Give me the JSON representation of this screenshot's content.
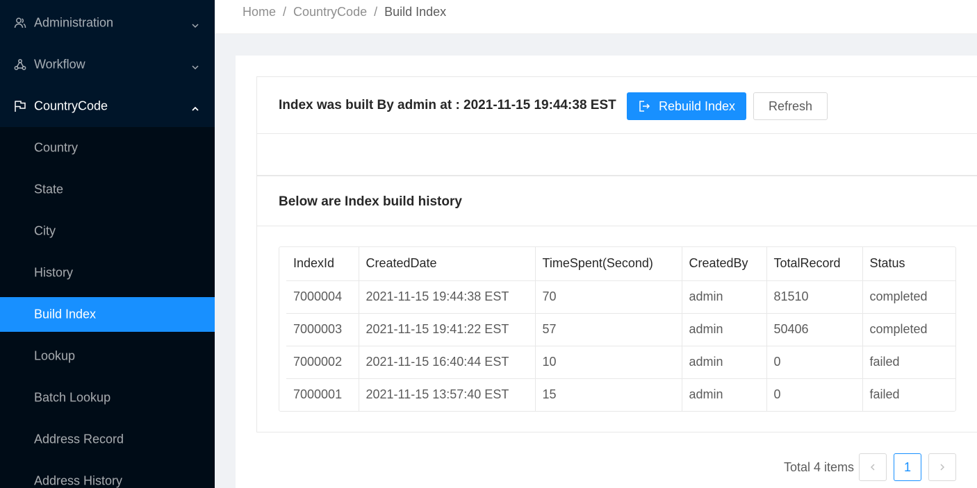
{
  "sidebar": {
    "items": [
      {
        "label": "Administration",
        "icon": "user-group-icon"
      },
      {
        "label": "Workflow",
        "icon": "workflow-icon"
      },
      {
        "label": "CountryCode",
        "icon": "flag-icon"
      }
    ],
    "submenu": [
      {
        "label": "Country"
      },
      {
        "label": "State"
      },
      {
        "label": "City"
      },
      {
        "label": "History"
      },
      {
        "label": "Build Index"
      },
      {
        "label": "Lookup"
      },
      {
        "label": "Batch Lookup"
      },
      {
        "label": "Address Record"
      },
      {
        "label": "Address History"
      }
    ],
    "selected_color": "#1890ff"
  },
  "breadcrumb": {
    "items": [
      "Home",
      "CountryCode",
      "Build Index"
    ],
    "separator": "/"
  },
  "index_status": {
    "text": "Index was built By admin at : 2021-11-15 19:44:38 EST",
    "rebuild_label": "Rebuild Index",
    "refresh_label": "Refresh"
  },
  "history": {
    "title": "Below are Index build history",
    "columns": [
      "IndexId",
      "CreatedDate",
      "TimeSpent(Second)",
      "CreatedBy",
      "TotalRecord",
      "Status"
    ],
    "rows": [
      [
        "7000004",
        "2021-11-15 19:44:38 EST",
        "70",
        "admin",
        "81510",
        "completed"
      ],
      [
        "7000003",
        "2021-11-15 19:41:22 EST",
        "57",
        "admin",
        "50406",
        "completed"
      ],
      [
        "7000002",
        "2021-11-15 16:40:44 EST",
        "10",
        "admin",
        "0",
        "failed"
      ],
      [
        "7000001",
        "2021-11-15 13:57:40 EST",
        "15",
        "admin",
        "0",
        "failed"
      ]
    ]
  },
  "pagination": {
    "total_text": "Total 4 items",
    "prev": "‹",
    "current": "1",
    "next": "›"
  }
}
